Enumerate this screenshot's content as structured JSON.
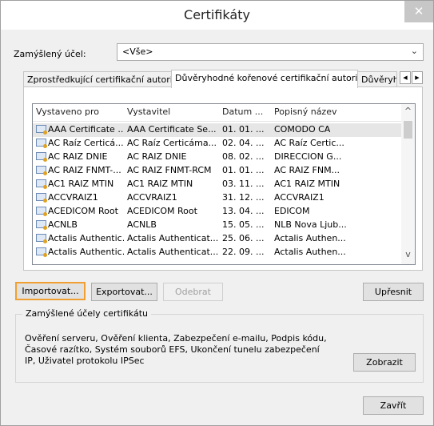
{
  "window": {
    "title": "Certifikáty",
    "close_glyph": "✕"
  },
  "purpose": {
    "label": "Zamýšlený účel:",
    "value": "<Vše>"
  },
  "tabs": [
    {
      "label": "Zprostředkující certifikační autority"
    },
    {
      "label": "Důvěryhodné kořenové certifikační autority"
    },
    {
      "label": "Důvěryho"
    }
  ],
  "tab_scroll": {
    "left": "◀",
    "right": "▶"
  },
  "columns": [
    "Vystaveno pro",
    "Vystavitel",
    "Datum ...",
    "Popisný název"
  ],
  "rows": [
    {
      "issued_to": "AAA Certificate ...",
      "issuer": "AAA Certificate Se...",
      "date": "01. 01. ...",
      "name": "COMODO CA"
    },
    {
      "issued_to": "AC Raíz Certicá...",
      "issuer": "AC Raíz Certicáma...",
      "date": "02. 04. ...",
      "name": "AC Raíz Certic..."
    },
    {
      "issued_to": "AC RAIZ DNIE",
      "issuer": "AC RAIZ DNIE",
      "date": "08. 02. ...",
      "name": "DIRECCION G..."
    },
    {
      "issued_to": "AC RAIZ FNMT-...",
      "issuer": "AC RAIZ FNMT-RCM",
      "date": "01. 01. ...",
      "name": "AC RAIZ FNM..."
    },
    {
      "issued_to": "AC1 RAIZ MTIN",
      "issuer": "AC1 RAIZ MTIN",
      "date": "03. 11. ...",
      "name": "AC1 RAIZ MTIN"
    },
    {
      "issued_to": "ACCVRAIZ1",
      "issuer": "ACCVRAIZ1",
      "date": "31. 12. ...",
      "name": "ACCVRAIZ1"
    },
    {
      "issued_to": "ACEDICOM Root",
      "issuer": "ACEDICOM Root",
      "date": "13. 04. ...",
      "name": "EDICOM"
    },
    {
      "issued_to": "ACNLB",
      "issuer": "ACNLB",
      "date": "15. 05. ...",
      "name": "NLB Nova Ljub..."
    },
    {
      "issued_to": "Actalis Authentic...",
      "issuer": "Actalis Authenticat...",
      "date": "25. 06. ...",
      "name": "Actalis Authen..."
    },
    {
      "issued_to": "Actalis Authentic...",
      "issuer": "Actalis Authenticat...",
      "date": "22. 09. ...",
      "name": "Actalis Authen..."
    }
  ],
  "scrollbar": {
    "up": "^",
    "down": "v"
  },
  "buttons": {
    "import": "Importovat...",
    "export": "Exportovat...",
    "remove": "Odebrat",
    "advanced": "Upřesnit",
    "view": "Zobrazit",
    "close": "Zavřít"
  },
  "purposes_group": {
    "title": "Zamýšlené účely certifikátu",
    "text": "Ověření serveru, Ověření klienta, Zabezpečení e-mailu, Podpis kódu, Časové razítko, Systém souborů EFS, Ukončení tunelu zabezpečení IP, Uživatel protokolu IPSec"
  }
}
